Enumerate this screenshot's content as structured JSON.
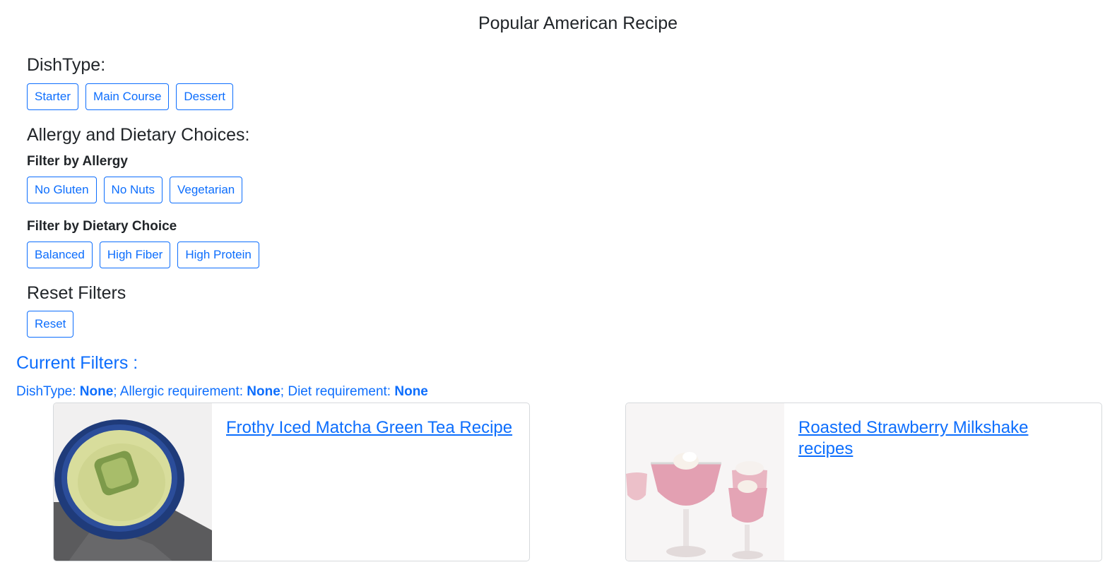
{
  "page": {
    "title": "Popular American Recipe"
  },
  "dish_type": {
    "heading": "DishType:",
    "buttons": [
      "Starter",
      "Main Course",
      "Dessert"
    ]
  },
  "allergy_diet": {
    "heading": "Allergy and Dietary Choices:",
    "allergy_label": "Filter by Allergy",
    "allergy_buttons": [
      "No Gluten",
      "No Nuts",
      "Vegetarian"
    ],
    "diet_label": "Filter by Dietary Choice",
    "diet_buttons": [
      "Balanced",
      "High Fiber",
      "High Protein"
    ]
  },
  "reset": {
    "heading": "Reset Filters",
    "button": "Reset"
  },
  "current_filters": {
    "title": "Current Filters :",
    "dishtype_label": "DishType:",
    "dishtype_value": "None",
    "allergic_label": "; Allergic requirement:",
    "allergic_value": "None",
    "diet_label": "; Diet requirement:",
    "diet_value": "None"
  },
  "recipes": [
    {
      "title": "Frothy Iced Matcha Green Tea Recipe",
      "image": "matcha-tea-image"
    },
    {
      "title": "Roasted Strawberry Milkshake recipes",
      "image": "strawberry-milkshake-image"
    }
  ],
  "colors": {
    "accent": "#0d6efd",
    "text": "#212529",
    "border": "#d6d9dc"
  }
}
